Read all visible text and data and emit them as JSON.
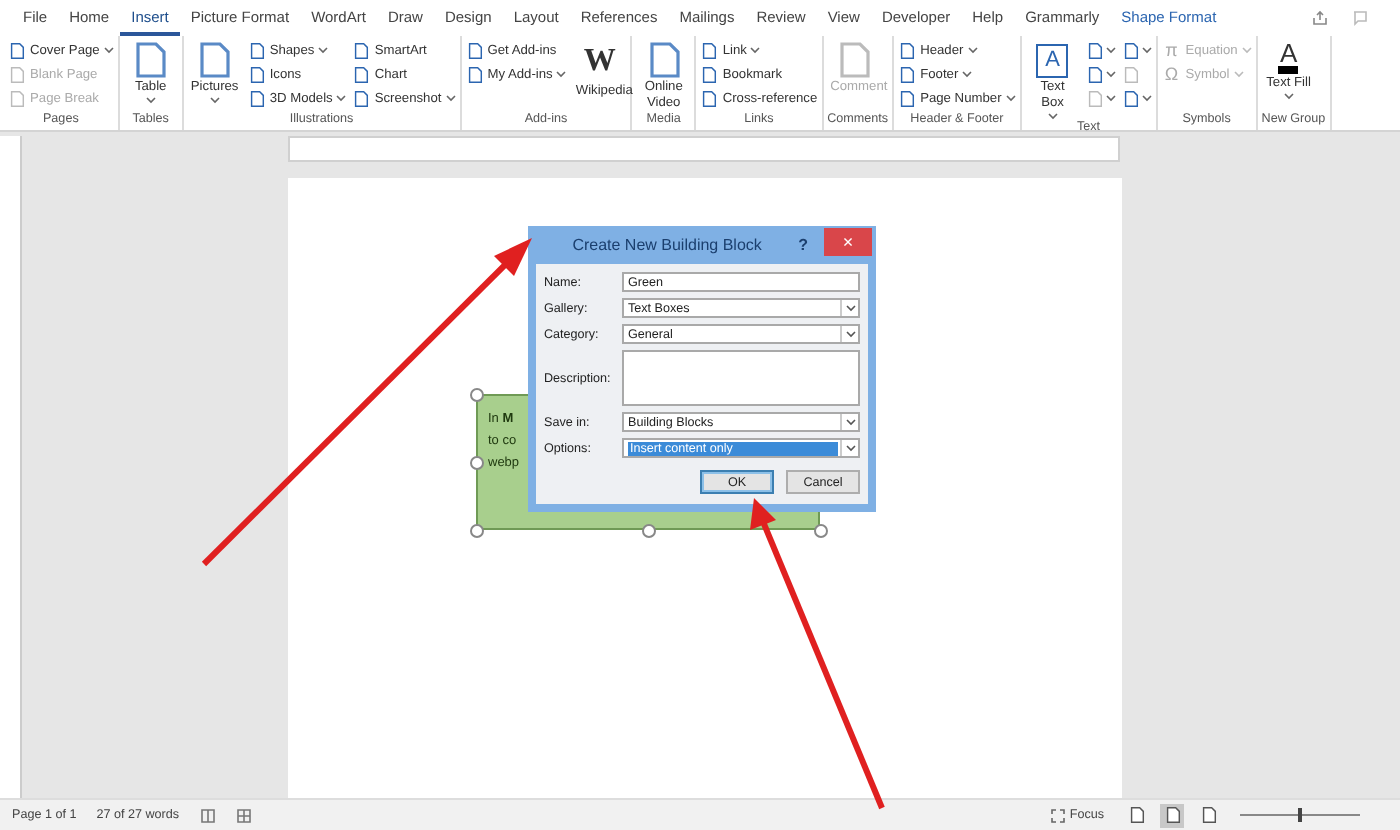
{
  "tabs": [
    {
      "label": "File",
      "selected": false,
      "contextual": false
    },
    {
      "label": "Home",
      "selected": false,
      "contextual": false
    },
    {
      "label": "Insert",
      "selected": true,
      "contextual": false
    },
    {
      "label": "Picture Format",
      "selected": false,
      "contextual": false
    },
    {
      "label": "WordArt",
      "selected": false,
      "contextual": false
    },
    {
      "label": "Draw",
      "selected": false,
      "contextual": false
    },
    {
      "label": "Design",
      "selected": false,
      "contextual": false
    },
    {
      "label": "Layout",
      "selected": false,
      "contextual": false
    },
    {
      "label": "References",
      "selected": false,
      "contextual": false
    },
    {
      "label": "Mailings",
      "selected": false,
      "contextual": false
    },
    {
      "label": "Review",
      "selected": false,
      "contextual": false
    },
    {
      "label": "View",
      "selected": false,
      "contextual": false
    },
    {
      "label": "Developer",
      "selected": false,
      "contextual": false
    },
    {
      "label": "Help",
      "selected": false,
      "contextual": false
    },
    {
      "label": "Grammarly",
      "selected": false,
      "contextual": false
    },
    {
      "label": "Shape Format",
      "selected": false,
      "contextual": true
    }
  ],
  "ribbon": [
    {
      "label": "Pages",
      "columns": [
        [
          {
            "kind": "small",
            "label": "Cover Page",
            "dropdown": true,
            "disabled": false
          },
          {
            "kind": "small",
            "label": "Blank Page",
            "dropdown": false,
            "disabled": true
          },
          {
            "kind": "small",
            "label": "Page Break",
            "dropdown": false,
            "disabled": true
          }
        ]
      ]
    },
    {
      "label": "Tables",
      "columns": [
        [
          {
            "kind": "large",
            "label": "Table",
            "dropdown": true,
            "disabled": false
          }
        ]
      ]
    },
    {
      "label": "Illustrations",
      "columns": [
        [
          {
            "kind": "large",
            "label": "Pictures",
            "dropdown": true,
            "disabled": false
          }
        ],
        [
          {
            "kind": "small",
            "label": "Shapes",
            "dropdown": true,
            "disabled": false
          },
          {
            "kind": "small",
            "label": "Icons",
            "dropdown": false,
            "disabled": false
          },
          {
            "kind": "small",
            "label": "3D Models",
            "dropdown": true,
            "disabled": false
          }
        ],
        [
          {
            "kind": "small",
            "label": "SmartArt",
            "dropdown": false,
            "disabled": false
          },
          {
            "kind": "small",
            "label": "Chart",
            "dropdown": false,
            "disabled": false
          },
          {
            "kind": "small",
            "label": "Screenshot",
            "dropdown": true,
            "disabled": false
          }
        ]
      ]
    },
    {
      "label": "Add-ins",
      "columns": [
        [
          {
            "kind": "small",
            "label": "Get Add-ins",
            "dropdown": false,
            "disabled": false
          },
          {
            "kind": "small",
            "label": "My Add-ins",
            "dropdown": true,
            "disabled": false
          }
        ],
        [
          {
            "kind": "large",
            "label": "Wikipedia",
            "glyph": "W",
            "dropdown": false,
            "disabled": false
          }
        ]
      ]
    },
    {
      "label": "Media",
      "columns": [
        [
          {
            "kind": "large",
            "label": "Online Video",
            "dropdown": false,
            "disabled": false
          }
        ]
      ]
    },
    {
      "label": "Links",
      "columns": [
        [
          {
            "kind": "small",
            "label": "Link",
            "dropdown": true,
            "disabled": false
          },
          {
            "kind": "small",
            "label": "Bookmark",
            "dropdown": false,
            "disabled": false
          },
          {
            "kind": "small",
            "label": "Cross-reference",
            "dropdown": false,
            "disabled": false
          }
        ]
      ]
    },
    {
      "label": "Comments",
      "columns": [
        [
          {
            "kind": "large",
            "label": "Comment",
            "dropdown": false,
            "disabled": true
          }
        ]
      ]
    },
    {
      "label": "Header & Footer",
      "columns": [
        [
          {
            "kind": "small",
            "label": "Header",
            "dropdown": true,
            "disabled": false
          },
          {
            "kind": "small",
            "label": "Footer",
            "dropdown": true,
            "disabled": false
          },
          {
            "kind": "small",
            "label": "Page Number",
            "dropdown": true,
            "disabled": false
          }
        ]
      ]
    },
    {
      "label": "Text",
      "columns": [
        [
          {
            "kind": "large",
            "label": "Text Box",
            "glyph": "A",
            "dropdown": true,
            "disabled": false
          }
        ],
        [
          {
            "kind": "icon",
            "dropdown": true,
            "disabled": false
          },
          {
            "kind": "icon",
            "dropdown": true,
            "disabled": false
          },
          {
            "kind": "icon",
            "dropdown": true,
            "disabled": true
          }
        ],
        [
          {
            "kind": "icon",
            "dropdown": true,
            "disabled": false
          },
          {
            "kind": "icon",
            "dropdown": false,
            "disabled": true
          },
          {
            "kind": "icon",
            "dropdown": true,
            "disabled": false
          }
        ]
      ]
    },
    {
      "label": "Symbols",
      "columns": [
        [
          {
            "kind": "small",
            "label": "Equation",
            "glyph": "π",
            "dropdown": true,
            "disabled": true
          },
          {
            "kind": "small",
            "label": "Symbol",
            "glyph": "Ω",
            "dropdown": true,
            "disabled": true
          }
        ]
      ]
    },
    {
      "label": "New Group",
      "columns": [
        [
          {
            "kind": "large",
            "label": "Text Fill",
            "glyph": "A",
            "dropdown": true,
            "disabled": false
          }
        ]
      ]
    }
  ],
  "text_box": {
    "lines": [
      "In **M**",
      "to co",
      "webp"
    ]
  },
  "dialog": {
    "title": "Create New Building Block",
    "help": "?",
    "close": "×",
    "fields": [
      {
        "label": "Name:",
        "kind": "text",
        "value": "Green",
        "focused": false
      },
      {
        "label": "Gallery:",
        "kind": "select",
        "value": "Text Boxes",
        "focused": false
      },
      {
        "label": "Category:",
        "kind": "select",
        "value": "General",
        "focused": false
      },
      {
        "label": "Description:",
        "kind": "textarea",
        "focused": false
      },
      {
        "label": "Save in:",
        "kind": "select",
        "value": "Building Blocks",
        "focused": false
      },
      {
        "label": "Options:",
        "kind": "select",
        "value": "Insert content only",
        "focused": true
      }
    ],
    "buttons": [
      {
        "label": "OK",
        "default": true
      },
      {
        "label": "Cancel",
        "default": false
      }
    ]
  },
  "status_bar": {
    "page": "Page 1 of 1",
    "words": "27 of 27 words",
    "focus": "Focus",
    "views": [
      {
        "selected": false
      },
      {
        "selected": true
      },
      {
        "selected": false
      }
    ],
    "zoom": {
      "level": 0.5
    }
  }
}
